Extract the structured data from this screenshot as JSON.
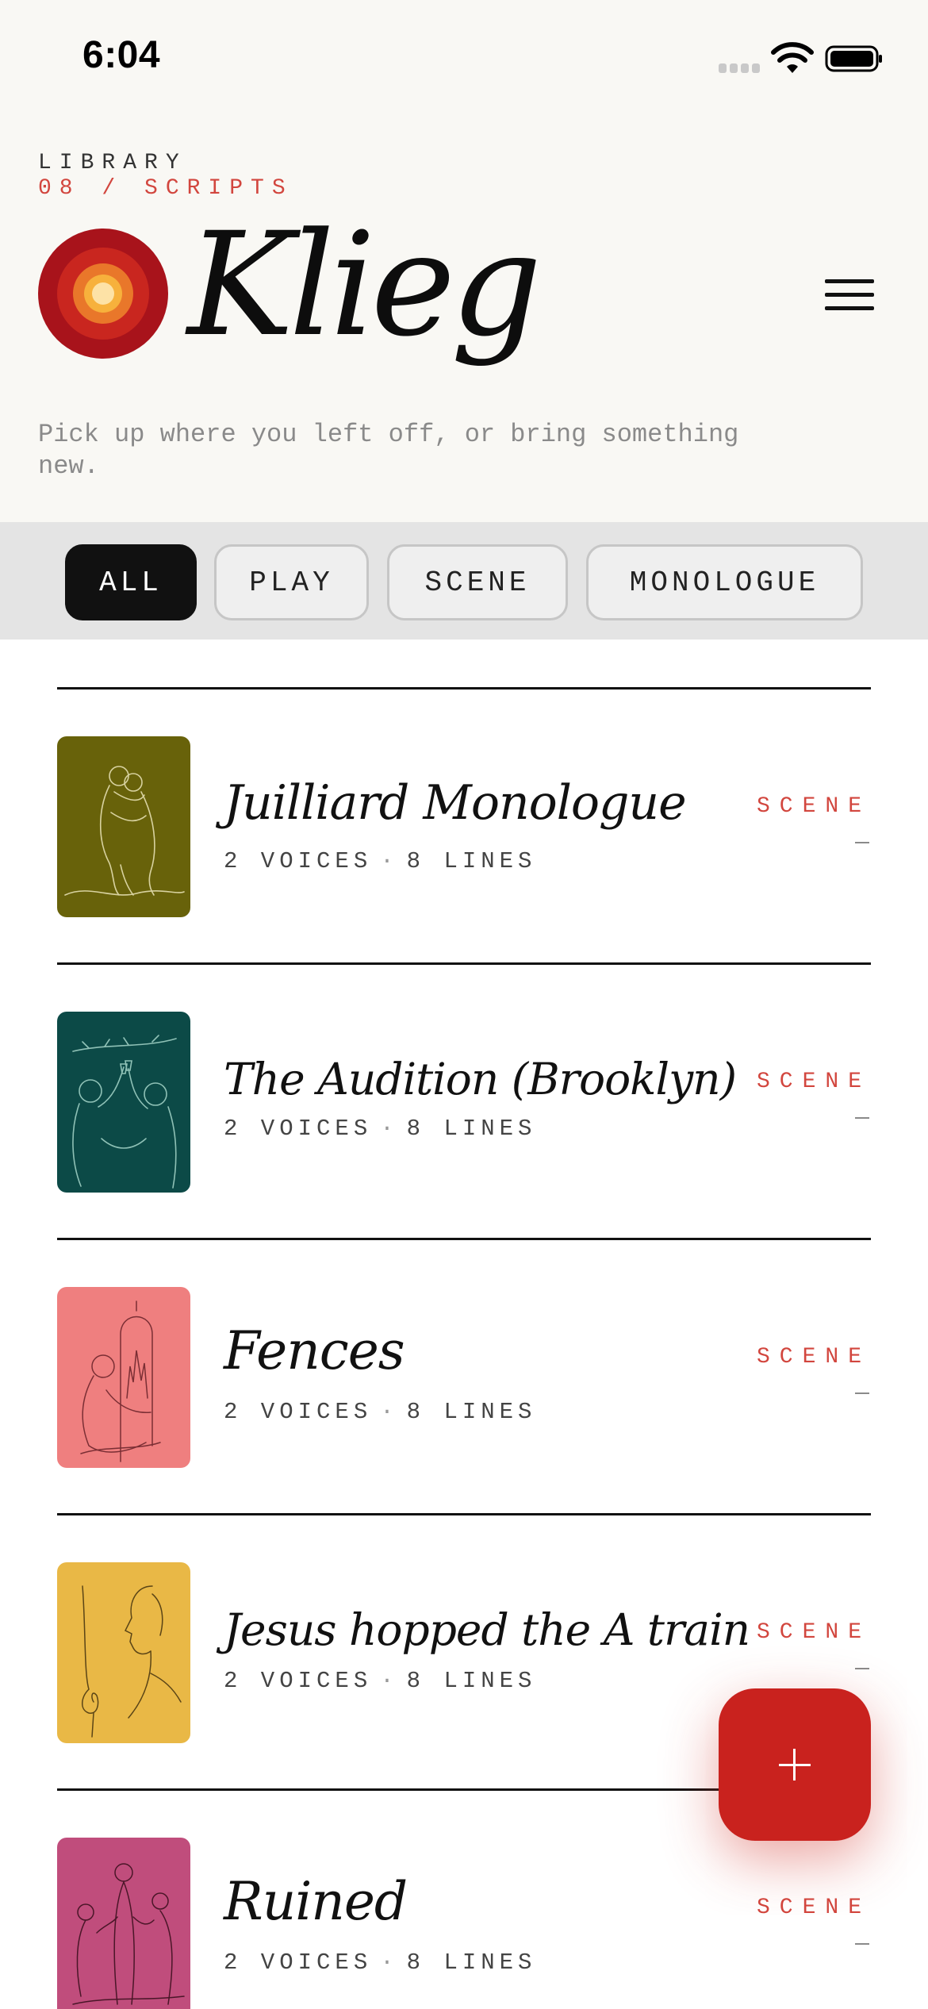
{
  "status_bar": {
    "time": "6:04"
  },
  "header": {
    "eyebrow": "LIBRARY",
    "count_line": "08 / SCRIPTS",
    "title": "Klieg",
    "subtitle": "Pick up where you left off, or bring something new.",
    "menu_icon": "hamburger-menu-icon"
  },
  "filters": [
    {
      "label": "ALL",
      "active": true
    },
    {
      "label": "PLAY",
      "active": false
    },
    {
      "label": "SCENE",
      "active": false
    },
    {
      "label": "MONOLOGUE",
      "active": false
    }
  ],
  "scripts": [
    {
      "title": "Juilliard Monologue",
      "voices": "2 VOICES",
      "lines": "8 LINES",
      "tag": "SCENE",
      "thumb_color": "#68620a",
      "thumb_icon": "embracing-couple-illustration"
    },
    {
      "title": "The Audition (Brooklyn)",
      "voices": "2 VOICES",
      "lines": "8 LINES",
      "tag": "SCENE",
      "thumb_color": "#0c4a47",
      "thumb_icon": "toasting-figures-illustration"
    },
    {
      "title": "Fences",
      "voices": "2 VOICES",
      "lines": "8 LINES",
      "tag": "SCENE",
      "thumb_color": "#ef7f7f",
      "thumb_icon": "figure-at-window-illustration"
    },
    {
      "title": "Jesus hopped the A train",
      "voices": "2 VOICES",
      "lines": "8 LINES",
      "tag": "SCENE",
      "thumb_color": "#e9b846",
      "thumb_icon": "face-profile-illustration"
    },
    {
      "title": "Ruined",
      "voices": "2 VOICES",
      "lines": "8 LINES",
      "tag": "SCENE",
      "thumb_color": "#c04d7c",
      "thumb_icon": "three-women-illustration"
    }
  ],
  "fab": {
    "icon": "plus-icon"
  },
  "colors": {
    "accent": "#c9221e",
    "tag": "#d2463e",
    "background": "#f9f8f4"
  }
}
